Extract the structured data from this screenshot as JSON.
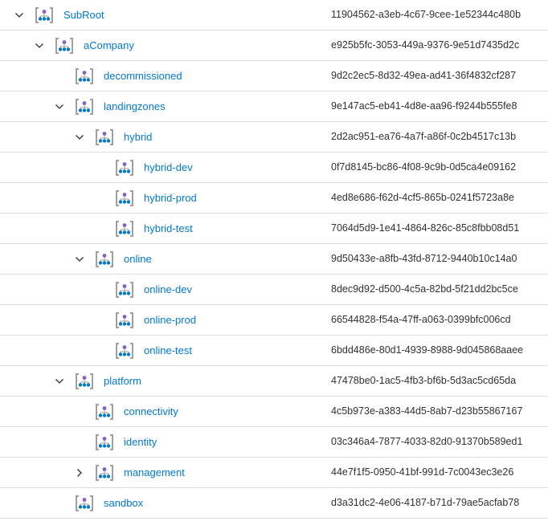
{
  "tree": {
    "rows": [
      {
        "level": 0,
        "expander": "expanded",
        "name": "SubRoot",
        "id": "11904562-a3eb-4c67-9cee-1e52344c480b"
      },
      {
        "level": 1,
        "expander": "expanded",
        "name": "aCompany",
        "id": "e925b5fc-3053-449a-9376-9e51d7435d2c"
      },
      {
        "level": 2,
        "expander": "none",
        "name": "decommissioned",
        "id": "9d2c2ec5-8d32-49ea-ad41-36f4832cf287"
      },
      {
        "level": 2,
        "expander": "expanded",
        "name": "landingzones",
        "id": "9e147ac5-eb41-4d8e-aa96-f9244b555fe8"
      },
      {
        "level": 3,
        "expander": "expanded",
        "name": "hybrid",
        "id": "2d2ac951-ea76-4a7f-a86f-0c2b4517c13b"
      },
      {
        "level": 4,
        "expander": "none",
        "name": "hybrid-dev",
        "id": "0f7d8145-bc86-4f08-9c9b-0d5ca4e09162"
      },
      {
        "level": 4,
        "expander": "none",
        "name": "hybrid-prod",
        "id": "4ed8e686-f62d-4cf5-865b-0241f5723a8e"
      },
      {
        "level": 4,
        "expander": "none",
        "name": "hybrid-test",
        "id": "7064d5d9-1e41-4864-826c-85c8fbb08d51"
      },
      {
        "level": 3,
        "expander": "expanded",
        "name": "online",
        "id": "9d50433e-a8fb-43fd-8712-9440b10c14a0"
      },
      {
        "level": 4,
        "expander": "none",
        "name": "online-dev",
        "id": "8dec9d92-d500-4c5a-82bd-5f21dd2bc5ce"
      },
      {
        "level": 4,
        "expander": "none",
        "name": "online-prod",
        "id": "66544828-f54a-47ff-a063-0399bfc006cd"
      },
      {
        "level": 4,
        "expander": "none",
        "name": "online-test",
        "id": "6bdd486e-80d1-4939-8988-9d045868aaee"
      },
      {
        "level": 2,
        "expander": "expanded",
        "name": "platform",
        "id": "47478be0-1ac5-4fb3-bf6b-5d3ac5cd65da"
      },
      {
        "level": 3,
        "expander": "none",
        "name": "connectivity",
        "id": "4c5b973e-a383-44d5-8ab7-d23b55867167"
      },
      {
        "level": 3,
        "expander": "none",
        "name": "identity",
        "id": "03c346a4-7877-4033-82d0-91370b589ed1"
      },
      {
        "level": 3,
        "expander": "collapsed",
        "name": "management",
        "id": "44e7f1f5-0950-41bf-991d-7c0043ec3e26"
      },
      {
        "level": 2,
        "expander": "none",
        "name": "sandbox",
        "id": "d3a31dc2-4e06-4187-b71d-79ae5acfab78"
      }
    ]
  },
  "colors": {
    "link": "#0078d4",
    "text": "#323130",
    "separator": "#e1dfdd",
    "icon_bracket": "#a19f9d",
    "icon_node_top": "#8661c5",
    "icon_node_bottom": "#0078d4"
  },
  "icons": {
    "row_icon": "management-group-icon",
    "expanded": "chevron-down-icon",
    "collapsed": "chevron-right-icon"
  }
}
